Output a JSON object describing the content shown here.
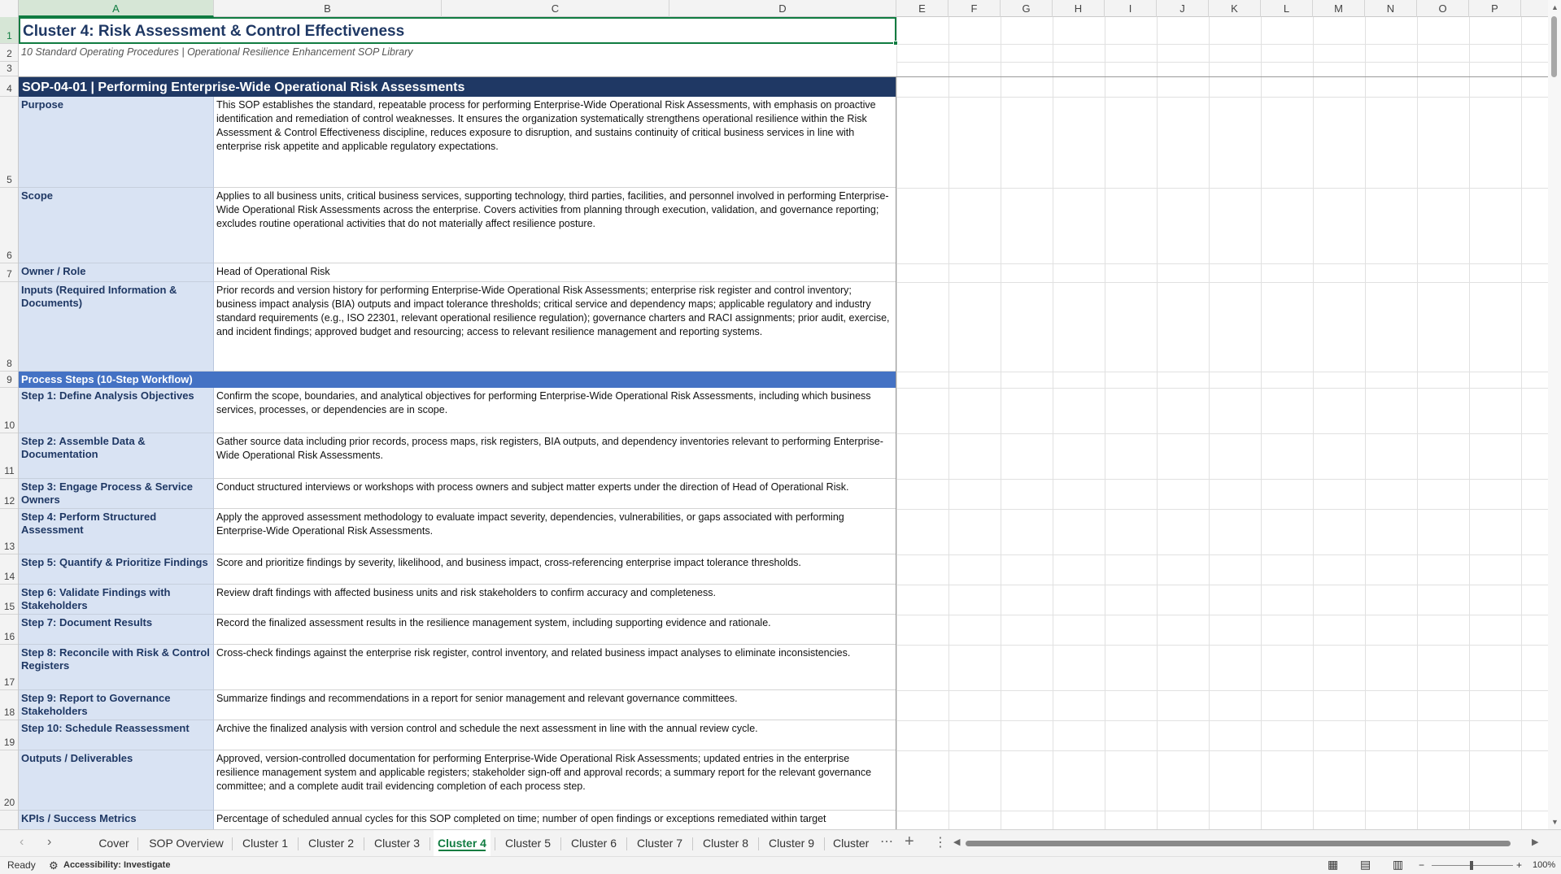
{
  "columns": [
    "A",
    "B",
    "C",
    "D",
    "E",
    "F",
    "G",
    "H",
    "I",
    "J",
    "K",
    "L",
    "M",
    "N",
    "O",
    "P"
  ],
  "rows": [
    "1",
    "2",
    "3",
    "4",
    "5",
    "6",
    "7",
    "8",
    "9",
    "10",
    "11",
    "12",
    "13",
    "14",
    "15",
    "16",
    "17",
    "18",
    "19",
    "20"
  ],
  "sheet": {
    "title": "Cluster 4: Risk Assessment & Control Effectiveness",
    "subtitle": "10 Standard Operating Procedures | Operational Resilience Enhancement SOP Library",
    "sop_heading": "SOP-04-01  |  Performing Enterprise-Wide Operational Risk Assessments",
    "process_heading": "Process Steps (10-Step Workflow)",
    "fields": [
      {
        "label": "Purpose",
        "value": "This SOP establishes the standard, repeatable process for performing Enterprise-Wide Operational Risk Assessments, with emphasis on proactive identification and remediation of control weaknesses. It ensures the organization systematically strengthens operational resilience within the Risk Assessment & Control Effectiveness discipline, reduces exposure to disruption, and sustains continuity of critical business services in line with enterprise risk appetite and applicable regulatory expectations."
      },
      {
        "label": "Scope",
        "value": "Applies to all business units, critical business services, supporting technology, third parties, facilities, and personnel involved in performing Enterprise-Wide Operational Risk Assessments across the enterprise. Covers activities from planning through execution, validation, and governance reporting; excludes routine operational activities that do not materially affect resilience posture."
      },
      {
        "label": "Owner / Role",
        "value": "Head of Operational Risk"
      },
      {
        "label": "Inputs (Required Information & Documents)",
        "value": "Prior records and version history for performing Enterprise-Wide Operational Risk Assessments; enterprise risk register and control inventory; business impact analysis (BIA) outputs and impact tolerance thresholds; critical service and dependency maps; applicable regulatory and industry standard requirements (e.g., ISO 22301, relevant operational resilience regulation); governance charters and RACI assignments; prior audit, exercise, and incident findings; approved budget and resourcing; access to relevant resilience management and reporting systems."
      }
    ],
    "steps": [
      {
        "label": "Step 1: Define Analysis Objectives",
        "value": "Confirm the scope, boundaries, and analytical objectives for performing Enterprise-Wide Operational Risk Assessments, including which business services, processes, or dependencies are in scope."
      },
      {
        "label": "Step 2: Assemble Data & Documentation",
        "value": "Gather source data including prior records, process maps, risk registers, BIA outputs, and dependency inventories relevant to performing Enterprise-Wide Operational Risk Assessments."
      },
      {
        "label": "Step 3: Engage Process & Service Owners",
        "value": "Conduct structured interviews or workshops with process owners and subject matter experts under the direction of Head of Operational Risk."
      },
      {
        "label": "Step 4: Perform Structured Assessment",
        "value": "Apply the approved assessment methodology to evaluate impact severity, dependencies, vulnerabilities, or gaps associated with performing Enterprise-Wide Operational Risk Assessments."
      },
      {
        "label": "Step 5: Quantify & Prioritize Findings",
        "value": "Score and prioritize findings by severity, likelihood, and business impact, cross-referencing enterprise impact tolerance thresholds."
      },
      {
        "label": "Step 6: Validate Findings with Stakeholders",
        "value": "Review draft findings with affected business units and risk stakeholders to confirm accuracy and completeness."
      },
      {
        "label": "Step 7: Document Results",
        "value": "Record the finalized assessment results in the resilience management system, including supporting evidence and rationale."
      },
      {
        "label": "Step 8: Reconcile with Risk & Control Registers",
        "value": "Cross-check findings against the enterprise risk register, control inventory, and related business impact analyses to eliminate inconsistencies."
      },
      {
        "label": "Step 9: Report to Governance Stakeholders",
        "value": "Summarize findings and recommendations in a report for senior management and relevant governance committees."
      },
      {
        "label": "Step 10: Schedule Reassessment",
        "value": "Archive the finalized analysis with version control and schedule the next assessment in line with the annual review cycle."
      }
    ],
    "outputs": {
      "label": "Outputs / Deliverables",
      "value": "Approved, version-controlled documentation for performing Enterprise-Wide Operational Risk Assessments; updated entries in the enterprise resilience management system and applicable registers; stakeholder sign-off and approval records; a summary report for the relevant governance committee; and a complete audit trail evidencing completion of each process step."
    },
    "kpis": {
      "label": "KPIs / Success Metrics",
      "value": "Percentage of scheduled annual cycles for this SOP completed on time; number of open findings or exceptions remediated within target"
    }
  },
  "tabs": [
    "Cover",
    "SOP Overview",
    "Cluster 1",
    "Cluster 2",
    "Cluster 3",
    "Cluster 4",
    "Cluster 5",
    "Cluster 6",
    "Cluster 7",
    "Cluster 8",
    "Cluster 9",
    "Cluster"
  ],
  "active_tab": "Cluster 4",
  "status": {
    "ready": "Ready",
    "accessibility": "Accessibility: Investigate",
    "zoom": "100%"
  },
  "colors": {
    "accent": "#107c41",
    "navy": "#1f3864",
    "blue": "#4472c4",
    "label_bg": "#d9e3f3"
  }
}
